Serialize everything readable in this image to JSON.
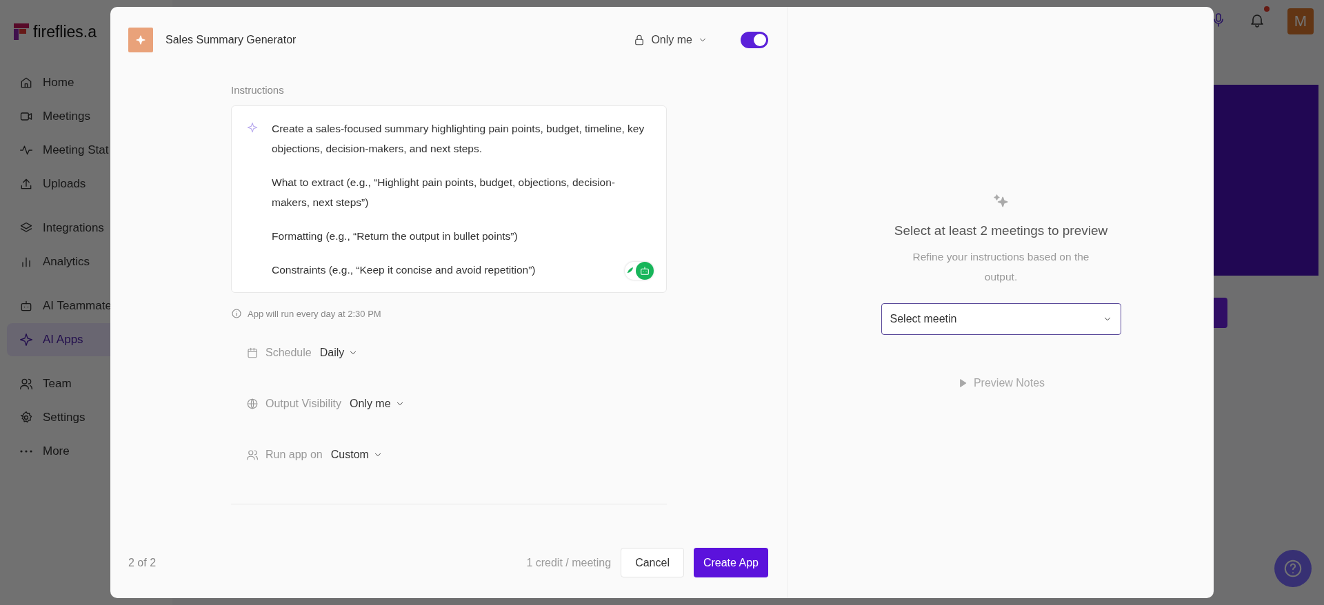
{
  "sidebar": {
    "logo": "fireflies.a",
    "groups": [
      [
        {
          "label": "Home",
          "selected": false
        },
        {
          "label": "Meetings",
          "selected": false
        },
        {
          "label": "Meeting Stat",
          "selected": false
        },
        {
          "label": "Uploads",
          "selected": false
        }
      ],
      [
        {
          "label": "Integrations",
          "selected": false
        },
        {
          "label": "Analytics",
          "selected": false
        }
      ],
      [
        {
          "label": "AI Teammate",
          "selected": false
        },
        {
          "label": "AI Apps",
          "selected": true
        }
      ],
      [
        {
          "label": "Team",
          "selected": false
        },
        {
          "label": "Settings",
          "selected": false
        },
        {
          "label": "More",
          "selected": false
        }
      ]
    ]
  },
  "topbar": {
    "avatar": "M"
  },
  "modal": {
    "app_name": "Sales Summary Generator",
    "visibility": "Only me",
    "enabled": true,
    "instructions_label": "Instructions",
    "instructions": [
      "Create a sales-focused summary highlighting pain points, budget, timeline, key objections, decision-makers, and next steps.",
      "What to extract (e.g., “Highlight pain points, budget, objections, decision-makers, next steps”)",
      "Formatting (e.g., “Return the output in bullet points”)",
      "Constraints (e.g., “Keep it concise and avoid repetition”)"
    ],
    "info": "App will run every day at 2:30 PM",
    "settings": [
      {
        "label": "Schedule",
        "value": "Daily"
      },
      {
        "label": "Output Visibility",
        "value": "Only me"
      },
      {
        "label": "Run app on",
        "value": "Custom"
      }
    ],
    "page": "2 of 2",
    "credit": "1 credit / meeting",
    "cancel": "Cancel",
    "create": "Create App"
  },
  "preview": {
    "title": "Select at least 2 meetings to preview",
    "subtitle": "Refine your instructions based on the output.",
    "select_value": "Select meetin",
    "button": "Preview Notes",
    "disabled": true
  }
}
